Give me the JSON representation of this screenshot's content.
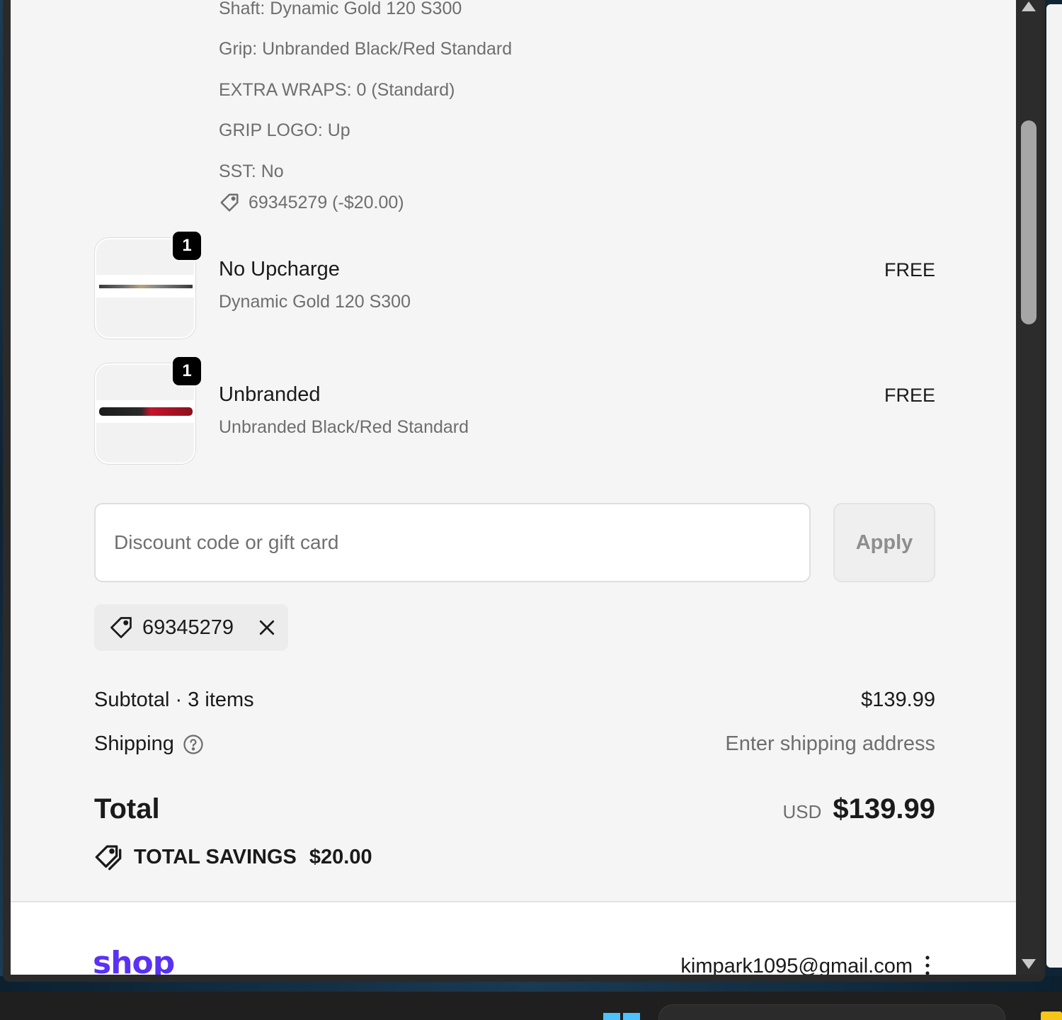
{
  "order_item_props": [
    "Shaft: Dynamic Gold 120 S300",
    "Grip: Unbranded Black/Red Standard",
    "EXTRA WRAPS: 0 (Standard)",
    "GRIP LOGO: Up",
    "SST: No"
  ],
  "item_discount": "69345279 (-$20.00)",
  "line_items": [
    {
      "qty": "1",
      "title": "No Upcharge",
      "subtitle": "Dynamic Gold 120 S300",
      "price": "FREE",
      "image_icon": "golf-shaft-image"
    },
    {
      "qty": "1",
      "title": "Unbranded",
      "subtitle": "Unbranded Black/Red Standard",
      "price": "FREE",
      "image_icon": "golf-grip-image"
    }
  ],
  "discount": {
    "placeholder": "Discount code or gift card",
    "value": "",
    "apply_label": "Apply",
    "applied_code": "69345279"
  },
  "summary": {
    "subtotal_label": "Subtotal · 3 items",
    "subtotal_value": "$139.99",
    "shipping_label": "Shipping",
    "shipping_value": "Enter shipping address",
    "total_label": "Total",
    "total_currency": "USD",
    "total_value": "$139.99",
    "savings_label": "TOTAL SAVINGS",
    "savings_value": "$20.00"
  },
  "footer": {
    "logo": "shop",
    "email": "kimpark1095@gmail.com"
  },
  "colors": {
    "page_bg": "#f5f5f5",
    "shop_brand": "#5a31f4",
    "text": "#1a1a1a",
    "muted": "#6e6e6e"
  }
}
